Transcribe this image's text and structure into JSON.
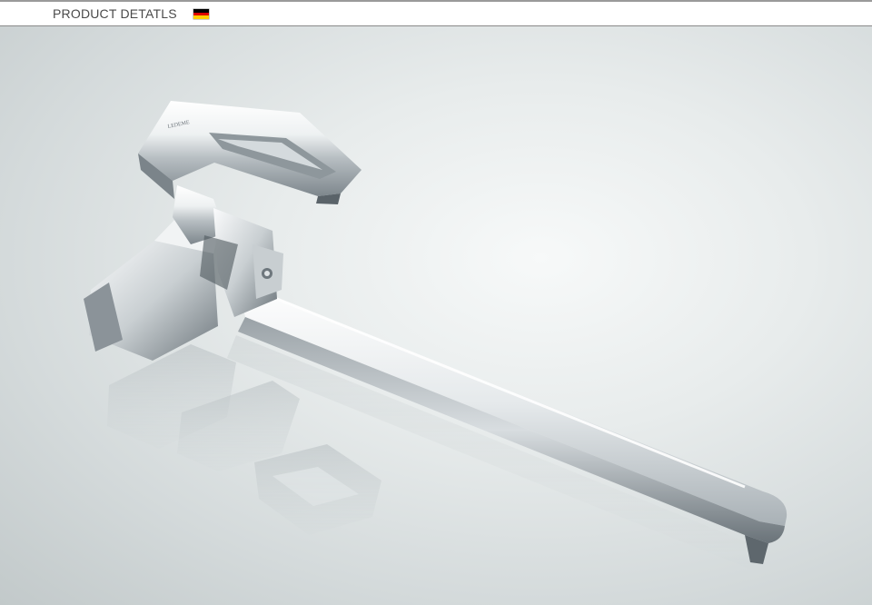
{
  "header": {
    "title": "PRODUCT DETATLS",
    "flag_icon": "germany-flag-icon",
    "flag_colors": [
      "#000000",
      "#dd0000",
      "#ffce00"
    ]
  },
  "photo": {
    "subject": "faucet-photo",
    "colors": {
      "chrome_light": "#f4f6f7",
      "chrome_mid": "#c3c9cc",
      "chrome_dark": "#5c646a",
      "background": "#dde2e3"
    }
  }
}
